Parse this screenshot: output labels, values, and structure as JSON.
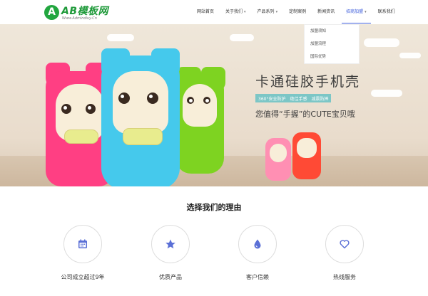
{
  "brand": {
    "logo_letter": "A",
    "name": "AB模板网",
    "url": "Www.Admindiuy.Cn",
    "accent": "#22a63f"
  },
  "nav": {
    "items": [
      {
        "label": "网站首页",
        "has_menu": false
      },
      {
        "label": "关于我们",
        "has_menu": true
      },
      {
        "label": "产品系列",
        "has_menu": true
      },
      {
        "label": "定制案例",
        "has_menu": false
      },
      {
        "label": "新闻资讯",
        "has_menu": false
      },
      {
        "label": "招商加盟",
        "has_menu": true,
        "active": true
      },
      {
        "label": "联系我们",
        "has_menu": false
      }
    ],
    "active_color": "#3b5bdb"
  },
  "dropdown": {
    "items": [
      "加盟须知",
      "加盟流程",
      "国际优势"
    ]
  },
  "banner": {
    "title": "卡通硅胶手机壳",
    "tags": [
      "360°安全防护",
      "绝佳手感",
      "减震防摔"
    ],
    "subtitle": "您值得“手握”的CUTE宝贝哦"
  },
  "section": {
    "title": "选择我们的理由"
  },
  "features": [
    {
      "label": "公司成立超过9年",
      "icon": "calendar-icon"
    },
    {
      "label": "优质产品",
      "icon": "star-icon"
    },
    {
      "label": "客户信赖",
      "icon": "drop-icon"
    },
    {
      "label": "热线服务",
      "icon": "heart-icon"
    }
  ]
}
